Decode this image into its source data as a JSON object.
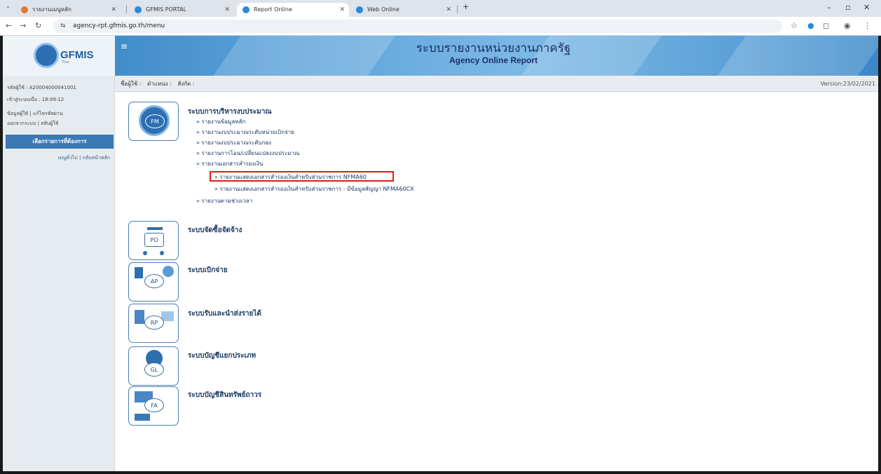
{
  "browser": {
    "tabs": [
      {
        "label": "รายงานเมนูหลัก"
      },
      {
        "label": "GFMIS PORTAL"
      },
      {
        "label": "Report Online"
      },
      {
        "label": "Web Online"
      }
    ],
    "url": "agency-rpt.gfmis.go.th/menu"
  },
  "header": {
    "logo_text": "GFMIS",
    "logo_sub": "Thai",
    "title": "ระบบรายงานหน่วยงานภาครัฐ",
    "subtitle": "Agency Online Report"
  },
  "info_bar": {
    "user_label": "ชื่อผู้ใช้ :",
    "position_label": "ตำแหน่ง :",
    "affiliation_label": "สังกัด :",
    "version": "Version:23/02/2021"
  },
  "sidebar": {
    "user_code": "รหัสผู้ใช้ : A20004000041001",
    "login_time": "เข้าสู่ระบบเมื่อ : 18:09:12",
    "profile_link": "ข้อมูลผู้ใช้",
    "change_password_link": "แก้ไขรหัสผ่าน",
    "logout_link": "ออกจากระบบ",
    "switch_user_link": "สลับผู้ใช้",
    "menu_button": "เลือกรายการที่ต้องการ",
    "general_menu_link": "เมนูทั่วไป",
    "home_link": "กลับหน้าหลัก",
    "separator": "|"
  },
  "modules": [
    {
      "code": "FM",
      "title": "ระบบการบริหารงบประมาณ",
      "links": [
        "» รายงานข้อมูลหลัก",
        "» รายงานงบประมาณระดับหน่วยเบิกจ่าย",
        "» รายงานงบประมาณระดับกอง",
        "» รายงานการโอน/เปลี่ยนแปลงงบประมาณ",
        "» รายงานเอกสารสำรองเงิน"
      ],
      "sub_links": [
        "» รายงานแสดงเอกสารสำรองเงินสำหรับส่วนราชการ NFMA60",
        "» รายงานแสดงเอกสารสำรองเงินสำหรับส่วนราชการ - มีข้อมูลสัญญา NFMA60CX"
      ],
      "last_link": "» รายงานตามช่วงเวลา"
    },
    {
      "code": "PO",
      "title": "ระบบจัดซื้อจัดจ้าง"
    },
    {
      "code": "AP",
      "title": "ระบบเบิกจ่าย"
    },
    {
      "code": "RP",
      "title": "ระบบรับและนำส่งรายได้"
    },
    {
      "code": "GL",
      "title": "ระบบบัญชีแยกประเภท"
    },
    {
      "code": "FA",
      "title": "ระบบบัญชีสินทรัพย์ถาวร"
    }
  ],
  "colors": {
    "header_blue": "#3b87c7",
    "sidebar_button": "#3a78b6",
    "highlight_red": "#e01919"
  }
}
